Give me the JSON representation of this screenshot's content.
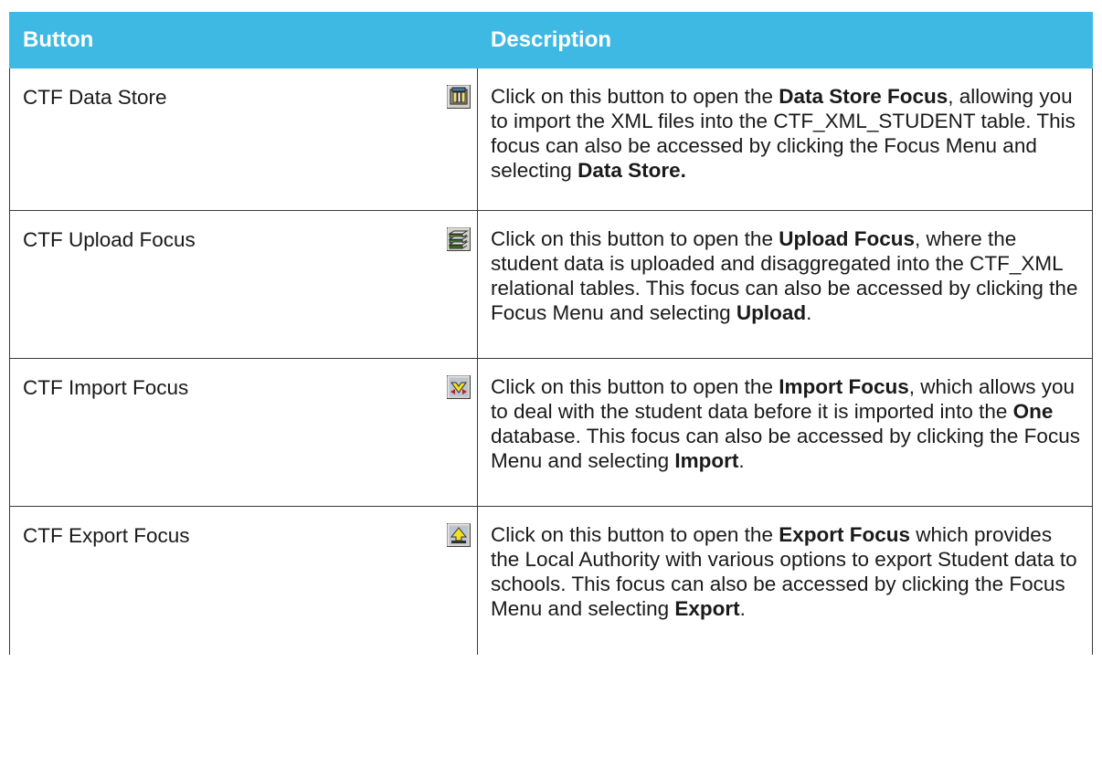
{
  "table": {
    "headers": {
      "button": "Button",
      "description": "Description"
    },
    "rows": [
      {
        "name": "CTF Data Store",
        "icon": "data-store-icon",
        "desc": [
          "Click on this button to open the ",
          "Data Store Focus",
          ", allowing you to import the XML files into the CTF_XML_STUDENT table. This focus can also be accessed by clicking the Focus Menu and selecting ",
          "Data Store.",
          ""
        ]
      },
      {
        "name": "CTF Upload Focus",
        "icon": "upload-focus-icon",
        "desc": [
          "Click on this button to open the ",
          "Upload Focus",
          ", where the student data is uploaded and disaggregated into the CTF_XML relational tables. This focus can also be accessed by clicking the Focus Menu and selecting ",
          "Upload",
          "."
        ]
      },
      {
        "name": "CTF Import Focus",
        "icon": "import-focus-icon",
        "desc": [
          "Click on this button to open the ",
          "Import Focus",
          ", which allows you to deal with the student data before it is imported into the ",
          "One",
          " database. This focus can also be accessed by clicking the Focus Menu and selecting ",
          "Import",
          "."
        ]
      },
      {
        "name": "CTF Export Focus",
        "icon": "export-focus-icon",
        "desc": [
          "Click on this button to open the ",
          "Export Focus",
          " which provides the Local Authority with various options to export Student data to schools. This focus can also be accessed by clicking the Focus Menu and selecting ",
          "Export",
          "."
        ]
      }
    ]
  },
  "colors": {
    "header_bg": "#3db9e4",
    "header_text": "#ffffff",
    "border": "#3a3a3a"
  }
}
